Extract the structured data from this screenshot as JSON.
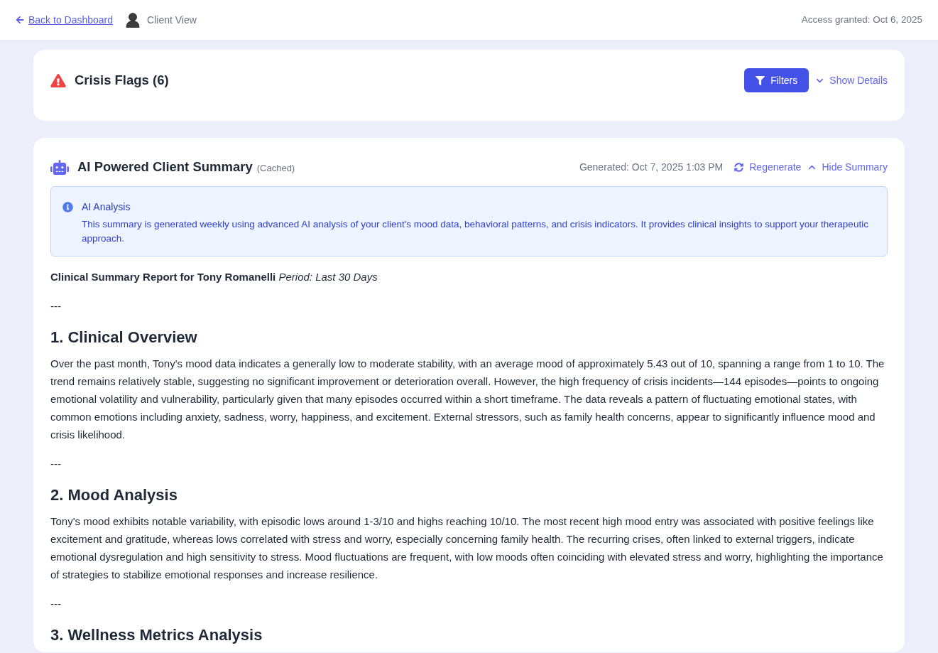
{
  "top_bar": {
    "back_link": "Back to Dashboard",
    "view_label": "Client View",
    "access": "Access granted: Oct 6, 2025"
  },
  "crisis_card": {
    "title": "Crisis Flags (6)",
    "filters_button": "Filters",
    "details_toggle": {
      "label": "Show Details",
      "expanded": false
    }
  },
  "summary_card": {
    "title": "AI Powered Client Summary",
    "cache_note": "(Cached)",
    "generated": "Generated: Oct 7, 2025 1:03 PM",
    "regenerate_button": "Regenerate",
    "summary_toggle": {
      "label": "Hide Summary",
      "expanded": true
    },
    "info_box": {
      "title": "AI Analysis",
      "text": "This summary is generated weekly using advanced AI analysis of your client's mood data, behavioral patterns, and crisis indicators. It provides clinical insights to support your therapeutic approach."
    },
    "report": [
      {
        "kind": "header",
        "text": "**Clinical Summary Report for Tony Romanelli** *Period: Last 30 Days*"
      },
      {
        "kind": "rule",
        "text": "---"
      },
      {
        "kind": "heading",
        "text": "1. Clinical Overview"
      },
      {
        "kind": "paragraph",
        "text": "Over the past month, Tony's mood data indicates a generally low to moderate stability, with an average mood of approximately 5.43 out of 10, spanning a range from 1 to 10. The trend remains relatively stable, suggesting no significant improvement or deterioration overall. However, the high frequency of crisis incidents—144 episodes—points to ongoing emotional volatility and vulnerability, particularly given that many episodes occurred within a short timeframe. The data reveals a pattern of fluctuating emotional states, with common emotions including anxiety, sadness, worry, happiness, and excitement. External stressors, such as family health concerns, appear to significantly influence mood and crisis likelihood."
      },
      {
        "kind": "rule",
        "text": "---"
      },
      {
        "kind": "heading",
        "text": "2. Mood Analysis"
      },
      {
        "kind": "paragraph",
        "text": "Tony's mood exhibits notable variability, with episodic lows around 1-3/10 and highs reaching 10/10. The most recent high mood entry was associated with positive feelings like excitement and gratitude, whereas lows correlated with stress and worry, especially concerning family health. The recurring crises, often linked to external triggers, indicate emotional dysregulation and high sensitivity to stress. Mood fluctuations are frequent, with low moods often coinciding with elevated stress and worry, highlighting the importance of strategies to stabilize emotional responses and increase resilience."
      },
      {
        "kind": "rule",
        "text": "---"
      },
      {
        "kind": "heading",
        "text": "3. Wellness Metrics Analysis"
      }
    ]
  }
}
